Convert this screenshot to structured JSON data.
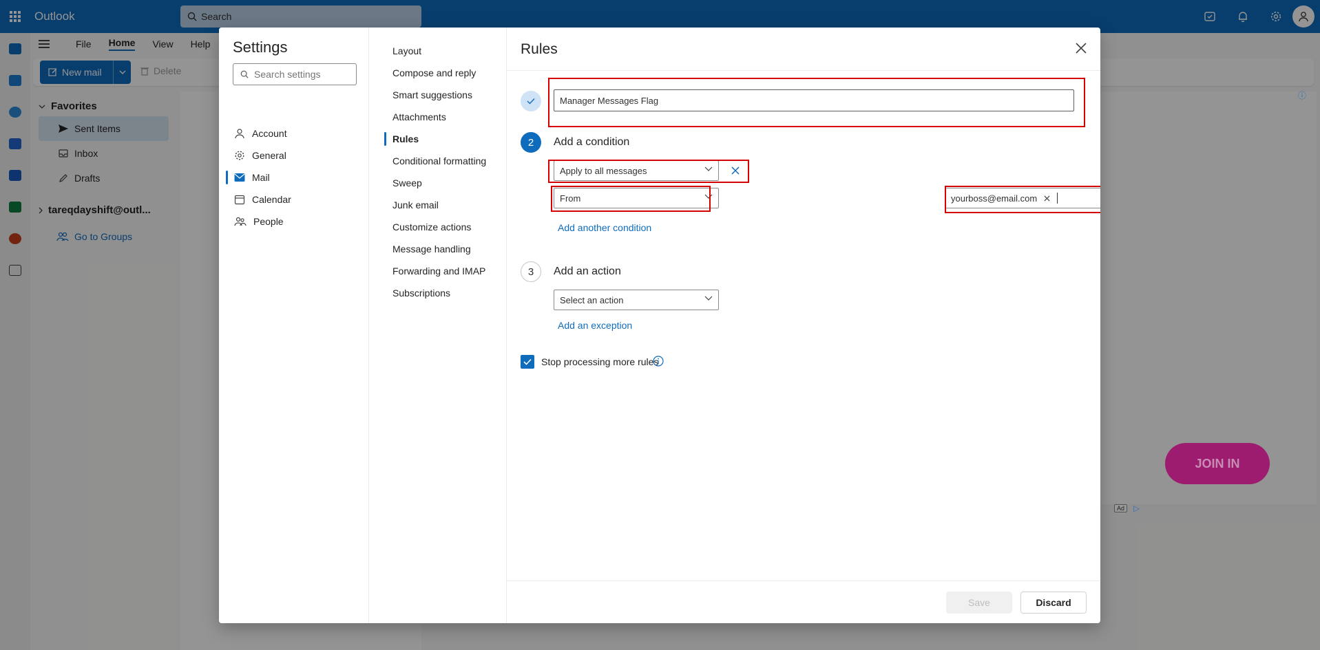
{
  "app": {
    "title": "Outlook"
  },
  "search": {
    "placeholder": "Search"
  },
  "ribbon": {
    "tabs": [
      {
        "label": "File"
      },
      {
        "label": "Home"
      },
      {
        "label": "View"
      },
      {
        "label": "Help"
      }
    ],
    "new_mail_label": "New mail",
    "delete_label": "Delete"
  },
  "folders": {
    "favorites_label": "Favorites",
    "items": [
      {
        "label": "Sent Items"
      },
      {
        "label": "Inbox"
      },
      {
        "label": "Drafts"
      }
    ],
    "account_label": "tareqdayshift@outl...",
    "groups_label": "Go to Groups"
  },
  "ad": {
    "button_label": "JOIN IN",
    "badge": "Ad"
  },
  "settings": {
    "title": "Settings",
    "search_placeholder": "Search settings",
    "categories": [
      {
        "label": "Account"
      },
      {
        "label": "General"
      },
      {
        "label": "Mail"
      },
      {
        "label": "Calendar"
      },
      {
        "label": "People"
      }
    ],
    "mail_subsections": [
      {
        "label": "Layout"
      },
      {
        "label": "Compose and reply"
      },
      {
        "label": "Smart suggestions"
      },
      {
        "label": "Attachments"
      },
      {
        "label": "Rules"
      },
      {
        "label": "Conditional formatting"
      },
      {
        "label": "Sweep"
      },
      {
        "label": "Junk email"
      },
      {
        "label": "Customize actions"
      },
      {
        "label": "Message handling"
      },
      {
        "label": "Forwarding and IMAP"
      },
      {
        "label": "Subscriptions"
      }
    ]
  },
  "rules": {
    "title": "Rules",
    "rule_name_value": "Manager Messages Flag",
    "step2_number": "2",
    "step2_label": "Add a condition",
    "condition1_value": "Apply to all messages",
    "condition2_value": "From",
    "from_tag": "yourboss@email.com",
    "add_condition_link": "Add another condition",
    "step3_number": "3",
    "step3_label": "Add an action",
    "action_placeholder": "Select an action",
    "add_exception_link": "Add an exception",
    "stop_processing_label": "Stop processing more rules",
    "stop_processing_checked": true,
    "save_label": "Save",
    "discard_label": "Discard"
  },
  "colors": {
    "brand": "#0f6cbd",
    "highlight": "#d40000"
  }
}
